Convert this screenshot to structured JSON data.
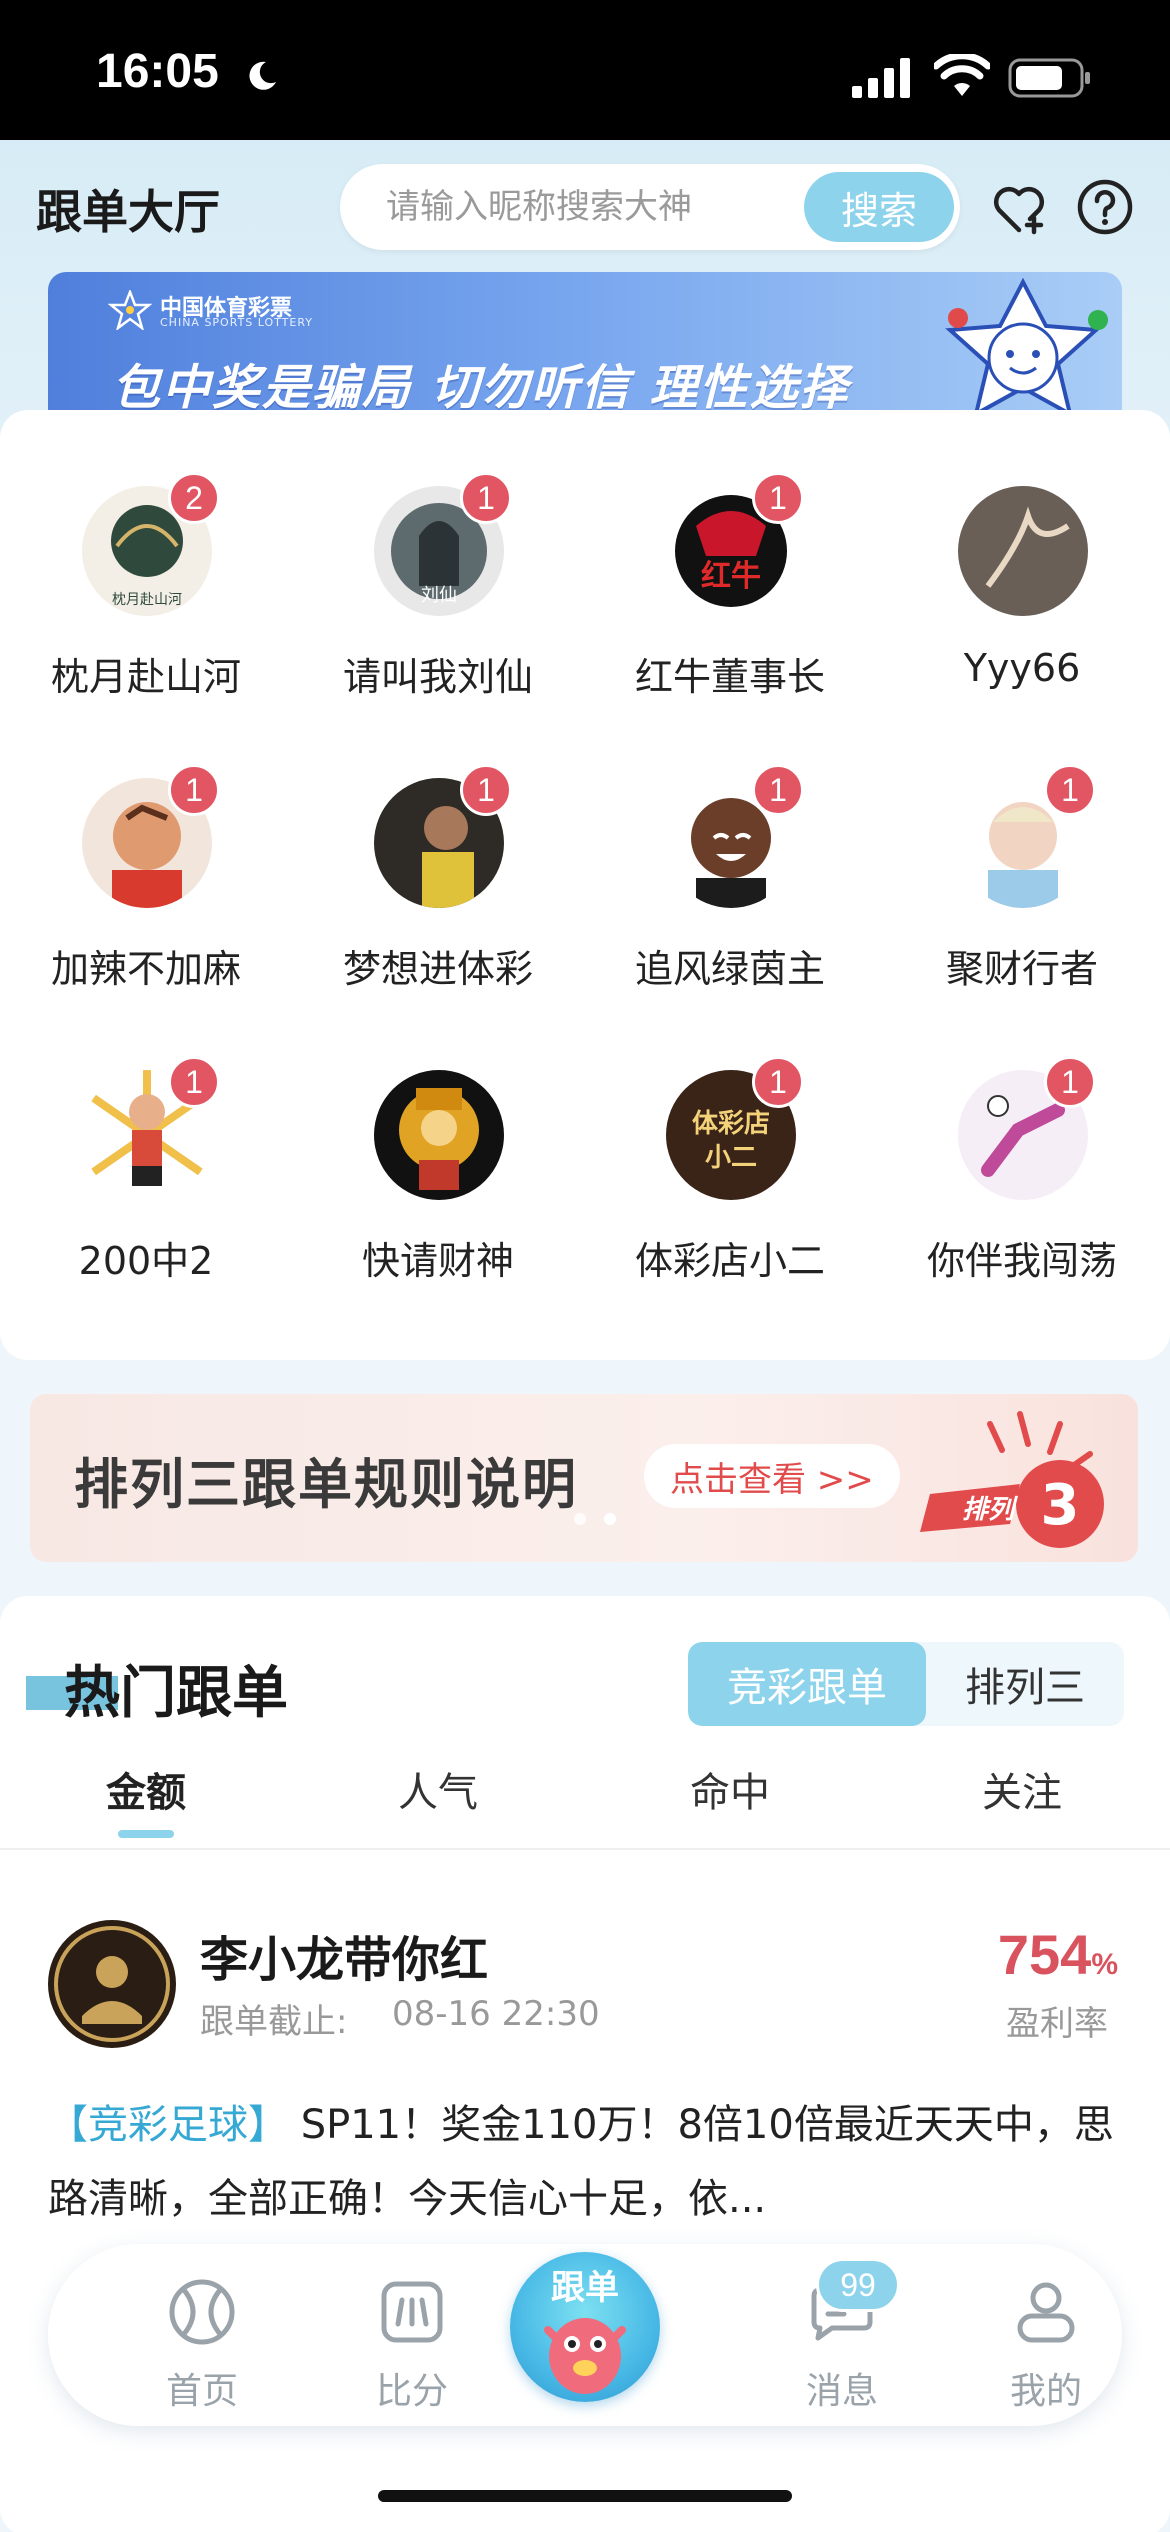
{
  "status_bar": {
    "time": "16:05"
  },
  "header": {
    "title": "跟单大厅",
    "search_placeholder": "请输入昵称搜索大神",
    "search_button": "搜索"
  },
  "banner": {
    "brand_cn": "中国体育彩票",
    "brand_en": "CHINA SPORTS LOTTERY",
    "slogan": "包中奖是骗局 切勿听信 理性选择"
  },
  "experts": [
    {
      "name": "枕月赴山河",
      "badge": "2",
      "avatar_color": "#2f4a3c"
    },
    {
      "name": "请叫我刘仙",
      "badge": "1",
      "avatar_color": "#5d6a6e"
    },
    {
      "name": "红牛董事长",
      "badge": "1",
      "avatar_color": "#7a1a1a"
    },
    {
      "name": "Yyy66",
      "badge": "",
      "avatar_color": "#6a5f57"
    },
    {
      "name": "加辣不加麻",
      "badge": "1",
      "avatar_color": "#c9673f"
    },
    {
      "name": "梦想进体彩",
      "badge": "1",
      "avatar_color": "#2e2a26"
    },
    {
      "name": "追风绿茵主",
      "badge": "1",
      "avatar_color": "#5a3a2c"
    },
    {
      "name": "聚财行者",
      "badge": "1",
      "avatar_color": "#a9cfe6"
    },
    {
      "name": "200中2",
      "badge": "1",
      "avatar_color": "#d84a3a"
    },
    {
      "name": "快请财神",
      "badge": "",
      "avatar_color": "#e0a323"
    },
    {
      "name": "体彩店小二",
      "badge": "1",
      "avatar_color": "#3a2418"
    },
    {
      "name": "你伴我闯荡",
      "badge": "1",
      "avatar_color": "#e7d3e8"
    }
  ],
  "rules_banner": {
    "title": "排列三跟单规则说明",
    "link": "点击查看 >>",
    "logo_text": "排列",
    "logo_num": "3"
  },
  "hot": {
    "title": "热门跟单",
    "segments": [
      "竞彩跟单",
      "排列三"
    ],
    "sort_tabs": [
      "金额",
      "人气",
      "命中",
      "关注"
    ]
  },
  "post": {
    "name": "李小龙带你红",
    "deadline_label": "跟单截止:",
    "deadline": "08-16 22:30",
    "rate_value": "754",
    "rate_unit": "%",
    "rate_label": "盈利率",
    "tag": "【竞彩足球】",
    "text": " SP11！奖金110万！8倍10倍最近天天中，思路清晰，全部正确！今天信心十足，依..."
  },
  "tabbar": {
    "home": "首页",
    "score": "比分",
    "center": "跟单",
    "messages": "消息",
    "messages_badge": "99",
    "mine": "我的"
  }
}
